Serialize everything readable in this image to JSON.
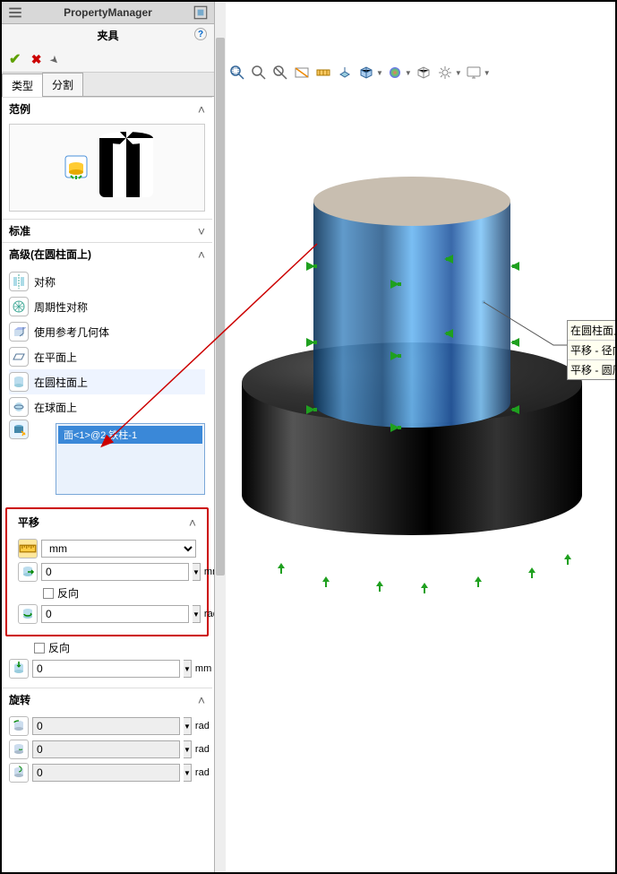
{
  "header": {
    "title": "PropertyManager",
    "subtitle": "夹具"
  },
  "tabs": {
    "type": "类型",
    "split": "分割"
  },
  "sections": {
    "example": {
      "title": "范例"
    },
    "standard": {
      "title": "标准"
    },
    "advanced": {
      "title": "高级(在圆柱面上)",
      "options": {
        "sym": "对称",
        "periodic": "周期性对称",
        "geom": "使用参考几何体",
        "plane": "在平面上",
        "cyl": "在圆柱面上",
        "sphere": "在球面上"
      },
      "selected_item": "面<1>@2.铁柱-1"
    },
    "translate": {
      "title": "平移",
      "unit": "mm",
      "val1": "0",
      "u1": "mm",
      "reverse1": "反向",
      "val2": "0",
      "u2": "rad",
      "reverse2": "反向",
      "val3": "0",
      "u3": "mm"
    },
    "rotate": {
      "title": "旋转",
      "val1": "0",
      "u1": "rad",
      "val2": "0",
      "u2": "rad",
      "val3": "0",
      "u3": "rad"
    }
  },
  "callout": {
    "r1": "在圆柱面上:",
    "r2": "平移 - 径向 (",
    "r3": "平移 - 圆周"
  }
}
